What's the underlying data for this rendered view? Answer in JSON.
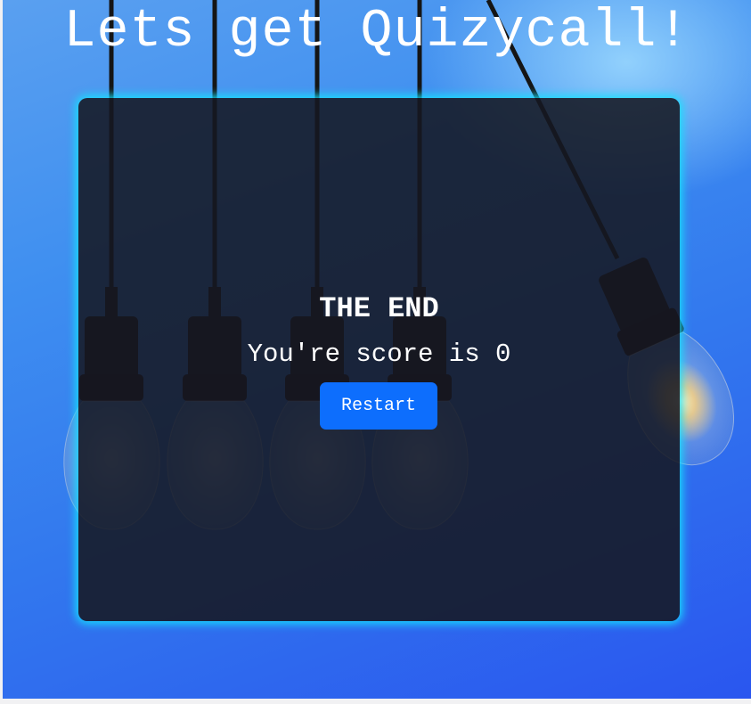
{
  "header": {
    "title": "Lets get Quizycall!"
  },
  "result": {
    "heading": "THE END",
    "score_text": "You're score is 0",
    "restart_label": "Restart"
  },
  "colors": {
    "background_top": "#5aa0f0",
    "background_bottom": "#2a56ef",
    "card": "#161822",
    "card_glow": "#14e1ff",
    "button": "#0d6efd",
    "text": "#ffffff"
  },
  "icons": {
    "decor": "hanging-lightbulbs-illustration"
  }
}
